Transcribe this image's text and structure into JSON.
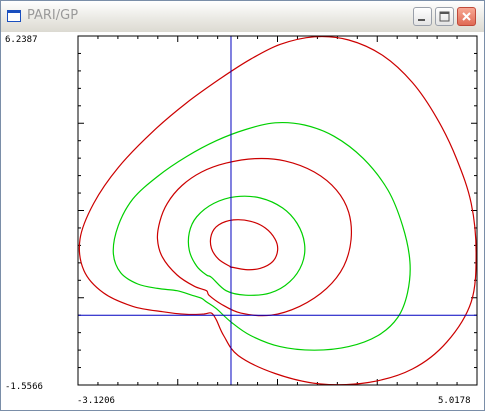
{
  "window": {
    "title": "PARI/GP"
  },
  "icons": {
    "app": "window-icon",
    "minimize": "minimize-icon",
    "maximize": "maximize-icon",
    "close": "close-icon"
  },
  "colors": {
    "frame": "#000000",
    "axes": "#0000c0",
    "curve_red": "#cc0000",
    "curve_green": "#00d000",
    "close_button": "#e06a55"
  },
  "plot": {
    "ymax_label": "6.2387",
    "ymin_label": "-1.5566",
    "xmin_label": "-3.1206",
    "xmax_label": "5.0178"
  },
  "chart_data": {
    "type": "line",
    "xlim": [
      -3.1206,
      5.0178
    ],
    "ylim": [
      -1.5566,
      6.2387
    ],
    "series": [
      {
        "color": "#cc0000",
        "x": [
          -0.4,
          -0.3,
          -0.15,
          0.15,
          0.9,
          1.8,
          2.8,
          3.7,
          4.4,
          4.9,
          5.0,
          4.9,
          4.6,
          4.2,
          3.7,
          3.1,
          2.4,
          1.7,
          1.0,
          0.4,
          -0.2,
          -0.9,
          -1.6,
          -2.3,
          -2.8,
          -3.08,
          -3.0,
          -2.6,
          -2.0,
          -1.4,
          -0.9,
          -0.55
        ],
        "y": [
          0.05,
          -0.1,
          -0.45,
          -0.9,
          -1.3,
          -1.53,
          -1.5,
          -1.2,
          -0.6,
          0.3,
          1.4,
          2.5,
          3.5,
          4.4,
          5.2,
          5.8,
          6.15,
          6.22,
          6.05,
          5.72,
          5.3,
          4.75,
          4.1,
          3.3,
          2.5,
          1.7,
          1.0,
          0.5,
          0.2,
          0.08,
          0.02,
          0.03
        ]
      },
      {
        "color": "#00d000",
        "x": [
          -0.5,
          -0.3,
          0.0,
          0.4,
          1.0,
          1.7,
          2.4,
          3.0,
          3.4,
          3.6,
          3.65,
          3.5,
          3.2,
          2.7,
          2.1,
          1.5,
          0.9,
          0.3,
          -0.3,
          -0.9,
          -1.5,
          -2.0,
          -2.3,
          -2.4,
          -2.25,
          -1.9,
          -1.5,
          -1.1,
          -0.8,
          -0.6
        ],
        "y": [
          0.3,
          0.15,
          -0.15,
          -0.45,
          -0.7,
          -0.78,
          -0.7,
          -0.45,
          -0.05,
          0.5,
          1.2,
          2.0,
          2.8,
          3.5,
          4.0,
          4.25,
          4.3,
          4.15,
          3.9,
          3.55,
          3.1,
          2.6,
          2.0,
          1.4,
          0.95,
          0.7,
          0.6,
          0.55,
          0.45,
          0.38
        ]
      },
      {
        "color": "#cc0000",
        "x": [
          -0.45,
          -0.2,
          0.2,
          0.8,
          1.4,
          1.95,
          2.3,
          2.45,
          2.4,
          2.15,
          1.7,
          1.1,
          0.5,
          -0.1,
          -0.6,
          -1.0,
          -1.3,
          -1.45,
          -1.5,
          -1.4,
          -1.1,
          -0.75,
          -0.5
        ],
        "y": [
          0.45,
          0.25,
          0.05,
          0.0,
          0.2,
          0.6,
          1.1,
          1.7,
          2.3,
          2.8,
          3.2,
          3.45,
          3.5,
          3.4,
          3.2,
          2.9,
          2.5,
          2.1,
          1.7,
          1.3,
          0.9,
          0.65,
          0.55
        ]
      },
      {
        "color": "#00d000",
        "x": [
          -0.4,
          -0.1,
          0.3,
          0.8,
          1.2,
          1.45,
          1.5,
          1.35,
          1.05,
          0.6,
          0.1,
          -0.35,
          -0.7,
          -0.85,
          -0.85,
          -0.7,
          -0.5
        ],
        "y": [
          0.85,
          0.55,
          0.45,
          0.5,
          0.75,
          1.15,
          1.6,
          2.05,
          2.4,
          2.62,
          2.65,
          2.5,
          2.2,
          1.85,
          1.45,
          1.1,
          0.9
        ]
      },
      {
        "color": "#cc0000",
        "x": [
          0.0,
          0.3,
          0.6,
          0.85,
          0.95,
          0.9,
          0.7,
          0.4,
          0.05,
          -0.25,
          -0.4,
          -0.4,
          -0.25,
          0.0
        ],
        "y": [
          1.08,
          1.02,
          1.05,
          1.2,
          1.45,
          1.7,
          1.95,
          2.1,
          2.13,
          2.02,
          1.8,
          1.5,
          1.25,
          1.08
        ]
      }
    ]
  }
}
